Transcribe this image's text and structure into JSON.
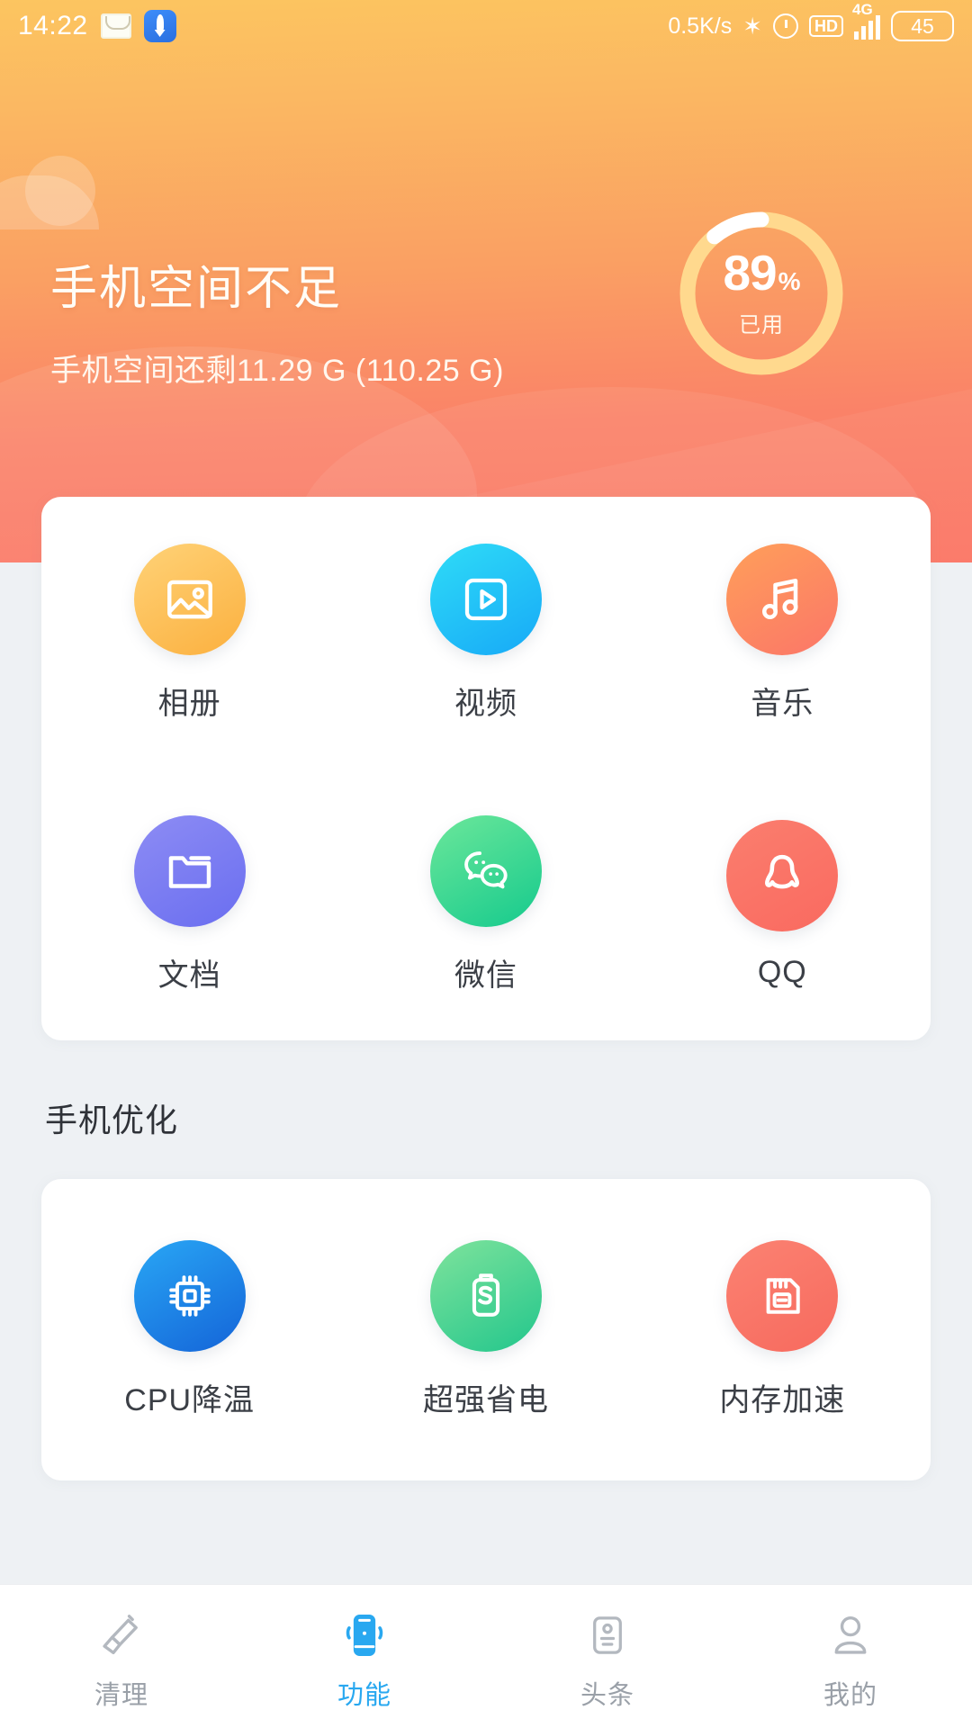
{
  "statusbar": {
    "time": "14:22",
    "envelope_icon": "envelope-icon",
    "rocket_icon": "rocket-icon",
    "net_speed": "0.5K/s",
    "bluetooth_icon": "bluetooth-icon",
    "bluetooth_glyph": "✶",
    "alarm_icon": "alarm-icon",
    "hd_label": "HD",
    "network_type": "4G",
    "battery_level": "45"
  },
  "header": {
    "title": "手机空间不足",
    "subtitle": "手机空间还剩11.29 G (110.25 G)",
    "ring": {
      "percent": "89",
      "percent_symbol": "%",
      "label": "已用",
      "used_pct": 89,
      "track_color": "#ffd98e",
      "progress_color": "#ffffff"
    },
    "gradient_top": "#fcc560",
    "gradient_bottom": "#fb7464"
  },
  "files_card": {
    "rows": [
      [
        {
          "label": "相册",
          "icon": "photo-album-icon",
          "gradient_class": "g-album",
          "color": "#fbb03f"
        },
        {
          "label": "视频",
          "icon": "video-play-icon",
          "gradient_class": "g-video",
          "color": "#17a9f7"
        },
        {
          "label": "音乐",
          "icon": "music-note-icon",
          "gradient_class": "g-music",
          "color": "#fb7668"
        }
      ],
      [
        {
          "label": "文档",
          "icon": "folder-icon",
          "gradient_class": "g-doc",
          "color": "#6a6ef0"
        },
        {
          "label": "微信",
          "icon": "wechat-icon",
          "gradient_class": "g-wechat",
          "color": "#15ca8d"
        },
        {
          "label": "QQ",
          "icon": "qq-penguin-icon",
          "gradient_class": "g-qq",
          "color": "#f96a60"
        }
      ]
    ]
  },
  "optimize_section": {
    "title": "手机优化",
    "items": [
      {
        "label": "CPU降温",
        "icon": "cpu-chip-icon",
        "gradient_class": "g-cpu",
        "color": "#1464d8"
      },
      {
        "label": "超强省电",
        "icon": "battery-saver-icon",
        "gradient_class": "g-power",
        "color": "#22c68c"
      },
      {
        "label": "内存加速",
        "icon": "memory-card-icon",
        "gradient_class": "g-mem",
        "color": "#f76a5e"
      }
    ]
  },
  "bottom_nav": {
    "active_color": "#29a8f0",
    "inactive_color": "#9aa0a8",
    "items": [
      {
        "label": "清理",
        "icon": "broom-icon",
        "active": false
      },
      {
        "label": "功能",
        "icon": "phone-vibrate-icon",
        "active": true
      },
      {
        "label": "头条",
        "icon": "news-card-icon",
        "active": false
      },
      {
        "label": "我的",
        "icon": "person-icon",
        "active": false
      }
    ]
  }
}
